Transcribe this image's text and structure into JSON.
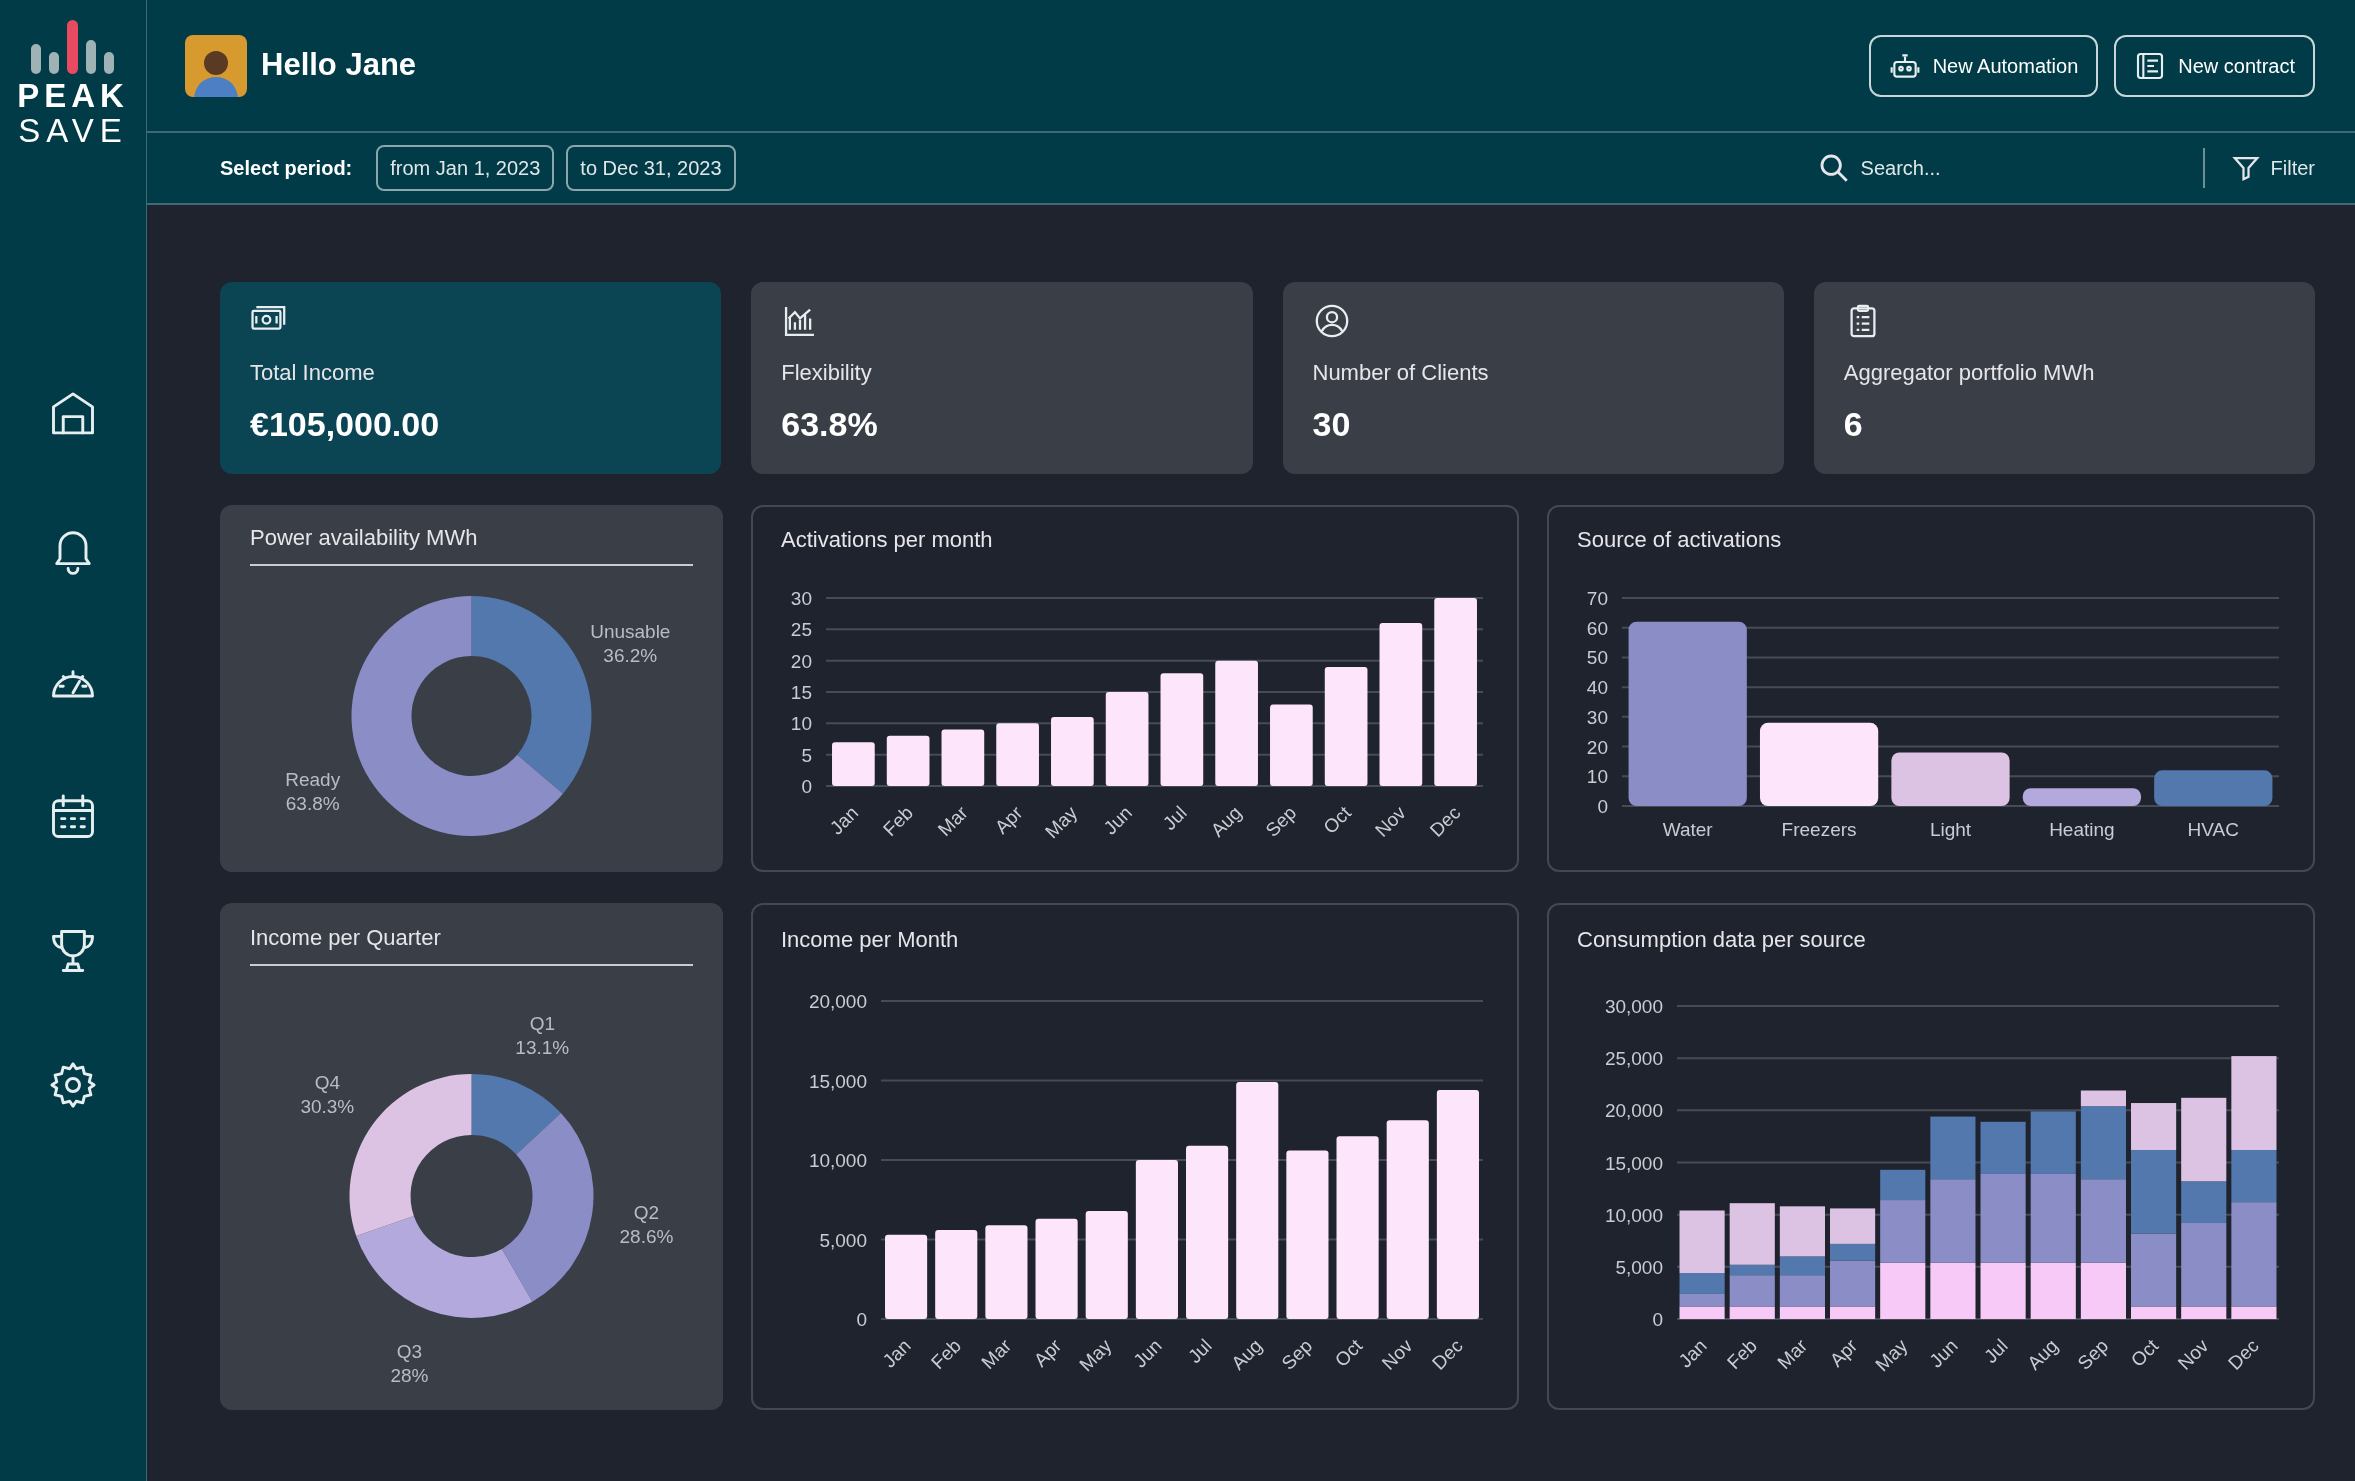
{
  "brand": {
    "line_1": "PEAK",
    "line_2": "SAVE"
  },
  "greeting": "Hello Jane",
  "header_buttons": [
    {
      "label": "New Automation"
    },
    {
      "label": "New contract"
    }
  ],
  "period": {
    "label": "Select period:",
    "from": "from Jan 1, 2023",
    "to": "to Dec 31, 2023"
  },
  "search": {
    "placeholder": "Search..."
  },
  "filter": {
    "label": "Filter"
  },
  "sidebar": {
    "items": [
      {
        "selected": false
      },
      {
        "selected": false
      },
      {
        "selected": false
      },
      {
        "selected": false
      },
      {
        "selected": false
      },
      {
        "selected": false
      }
    ]
  },
  "kpis": [
    {
      "label": "Total Income",
      "value": "€105,000.00",
      "selected": true
    },
    {
      "label": "Flexibility",
      "value": "63.8%",
      "selected": false
    },
    {
      "label": "Number of Clients",
      "value": "30",
      "selected": false
    },
    {
      "label": "Aggregator portfolio MWh",
      "value": "6",
      "selected": false
    }
  ],
  "power_availability": {
    "title": "Power availability MWh",
    "chart_data": {
      "type": "donut",
      "categories": [
        "Unusable",
        "Ready"
      ],
      "values": [
        36.2,
        63.8
      ],
      "value_labels": [
        "36.2%",
        "63.8%"
      ],
      "colors": [
        "#5278ad",
        "#8a8dc6"
      ]
    }
  },
  "activations_per_month": {
    "title": "Activations per month",
    "chart_data": {
      "type": "bar",
      "categories": [
        "Jan",
        "Feb",
        "Mar",
        "Apr",
        "May",
        "Jun",
        "Jul",
        "Aug",
        "Sep",
        "Oct",
        "Nov",
        "Dec"
      ],
      "grid": true,
      "ylim": [
        0,
        30
      ],
      "yticks": [
        0,
        5,
        10,
        15,
        20,
        25,
        30
      ],
      "series": [
        {
          "color": "#fde6fb",
          "values": [
            7,
            8,
            9,
            10,
            11,
            15,
            18,
            20,
            13,
            19,
            26,
            30
          ]
        }
      ]
    }
  },
  "source_of_activations": {
    "title": "Source of activations",
    "chart_data": {
      "type": "bar",
      "categories": [
        "Water",
        "Freezers",
        "Light",
        "Heating",
        "HVAC"
      ],
      "grid": true,
      "ylim": [
        0,
        70
      ],
      "yticks": [
        0,
        10,
        20,
        30,
        40,
        50,
        60,
        70
      ],
      "values": [
        62,
        28,
        18,
        6,
        12
      ],
      "colors": [
        "#8a8dc6",
        "#fde6fb",
        "#dcc3e3",
        "#b3a9dc",
        "#5278ad"
      ]
    }
  },
  "income_per_quarter": {
    "title": "Income per Quarter",
    "chart_data": {
      "type": "donut",
      "categories": [
        "Q1",
        "Q2",
        "Q3",
        "Q4"
      ],
      "values": [
        13.1,
        28.6,
        28,
        30.3
      ],
      "value_labels": [
        "13.1%",
        "28.6%",
        "28%",
        "30.3%"
      ],
      "colors": [
        "#5278ad",
        "#8a8dc6",
        "#b3a9dc",
        "#dcc3e3"
      ]
    }
  },
  "income_per_month": {
    "title": "Income per Month",
    "chart_data": {
      "type": "bar",
      "categories": [
        "Jan",
        "Feb",
        "Mar",
        "Apr",
        "May",
        "Jun",
        "Jul",
        "Aug",
        "Sep",
        "Oct",
        "Nov",
        "Dec"
      ],
      "grid": true,
      "ylim": [
        0,
        20000
      ],
      "yticks": [
        {
          "value": 0,
          "label": "0"
        },
        {
          "value": 5000,
          "label": "5,000"
        },
        {
          "value": 10000,
          "label": "10,000"
        },
        {
          "value": 15000,
          "label": "15,000"
        },
        {
          "value": 20000,
          "label": "20,000"
        }
      ],
      "series": [
        {
          "color": "#fde6fb",
          "values": [
            5300,
            5600,
            5900,
            6300,
            6800,
            10000,
            10900,
            14900,
            10600,
            11500,
            12500,
            14400
          ]
        }
      ]
    }
  },
  "consumption_per_source": {
    "title": "Consumption data per source",
    "chart_data": {
      "type": "bar",
      "stacked": true,
      "categories": [
        "Jan",
        "Feb",
        "Mar",
        "Apr",
        "May",
        "Jun",
        "Jul",
        "Aug",
        "Sep",
        "Oct",
        "Nov",
        "Dec"
      ],
      "grid": true,
      "ylim": [
        0,
        30000
      ],
      "yticks": [
        {
          "value": 0,
          "label": "0"
        },
        {
          "value": 5000,
          "label": "5,000"
        },
        {
          "value": 10000,
          "label": "10,000"
        },
        {
          "value": 15000,
          "label": "15,000"
        },
        {
          "value": 20000,
          "label": "20,000"
        },
        {
          "value": 25000,
          "label": "25,000"
        },
        {
          "value": 30000,
          "label": "30,000"
        }
      ],
      "series": [
        {
          "color": "#f7c9f7",
          "values": [
            1200,
            1200,
            1200,
            1200,
            5400,
            5400,
            5400,
            5400,
            5400,
            1200,
            1200,
            1200
          ]
        },
        {
          "color": "#8a8dc6",
          "values": [
            1200,
            3000,
            3000,
            4400,
            6000,
            8000,
            8500,
            8500,
            8000,
            7000,
            8000,
            10000
          ]
        },
        {
          "color": "#5278ad",
          "values": [
            2000,
            1000,
            1800,
            1600,
            2900,
            6000,
            5000,
            6000,
            7000,
            8000,
            4000,
            5000
          ]
        },
        {
          "color": "#dcc3e3",
          "values": [
            6000,
            5900,
            4800,
            3400,
            0,
            0,
            0,
            0,
            1500,
            4500,
            8000,
            9000
          ]
        }
      ]
    }
  }
}
